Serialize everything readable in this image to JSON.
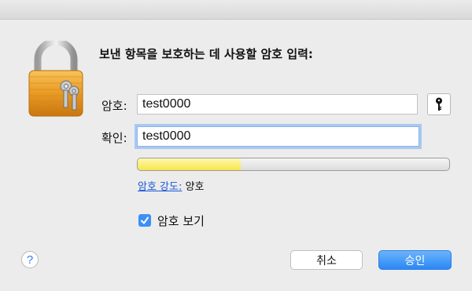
{
  "dialog": {
    "heading": "보낸 항목을 보호하는 데 사용할 암호 입력:"
  },
  "form": {
    "password_label": "암호:",
    "password_value": "test0000",
    "confirm_label": "확인:",
    "confirm_value": "test0000"
  },
  "strength": {
    "link_label": "암호 강도:",
    "value_label": "양호",
    "level": 0.33,
    "bar_color": "#f7e64a"
  },
  "show_password": {
    "label": "암호 보기",
    "checked": true
  },
  "buttons": {
    "help": "?",
    "cancel": "취소",
    "ok": "승인"
  },
  "icons": {
    "lock": "lock-with-keys-icon",
    "key": "key-icon",
    "checkmark": "checkmark-icon"
  },
  "colors": {
    "accent": "#2b88f5",
    "link": "#1a55d6"
  }
}
